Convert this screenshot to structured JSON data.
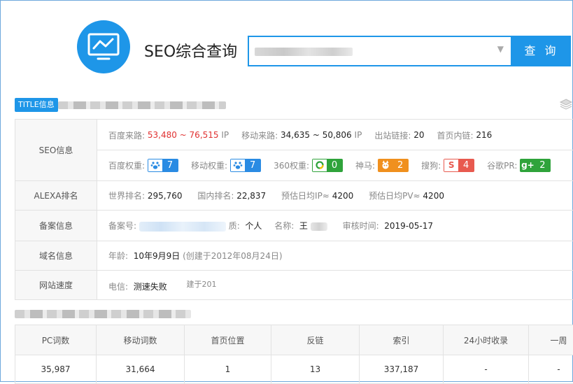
{
  "header": {
    "title": "SEO综合查询",
    "search_button": "查 询",
    "search_caret": "▼"
  },
  "title_badge": "TITLE信息",
  "seo": {
    "label": "SEO信息",
    "baidu_traffic_label": "百度来路:",
    "baidu_traffic_value": "53,480 ~ 76,515",
    "baidu_traffic_unit": "IP",
    "mobile_traffic_label": "移动来路:",
    "mobile_traffic_value": "34,635 ~ 50,806",
    "mobile_traffic_unit": "IP",
    "outbound_label": "出站链接:",
    "outbound_value": "20",
    "inner_label": "首页内链:",
    "inner_value": "216",
    "baidu_weight_label": "百度权重:",
    "baidu_weight_value": "7",
    "mobile_weight_label": "移动权重:",
    "mobile_weight_value": "7",
    "w360_label": "360权重:",
    "w360_value": "0",
    "shenma_label": "神马:",
    "shenma_value": "2",
    "sogou_label": "搜狗:",
    "sogou_value": "4",
    "sogou_glyph": "S",
    "google_label": "谷歌PR:",
    "google_value": "2",
    "google_glyph": "g+"
  },
  "alexa": {
    "label": "ALEXA排名",
    "world_label": "世界排名:",
    "world_value": "295,760",
    "domestic_label": "国内排名:",
    "domestic_value": "22,837",
    "ip_label": "预估日均IP≈",
    "ip_value": "4200",
    "pv_label": "预估日均PV≈",
    "pv_value": "4200"
  },
  "icp": {
    "label": "备案信息",
    "no_label": "备案号:",
    "nature_label": "质:",
    "nature_value": "个人",
    "name_label": "名称:",
    "name_value": "王",
    "review_label": "审核时间:",
    "review_value": "2019-05-17"
  },
  "domain": {
    "label": "域名信息",
    "age_label": "年龄:",
    "age_value": "10年9月9日",
    "created_note": "(创建于2012年08月24日)"
  },
  "speed": {
    "label": "网站速度",
    "telecom_label": "电信:",
    "telecom_value": "测速失败",
    "fragment": "建于201"
  },
  "kw_table": {
    "headers": [
      "PC词数",
      "移动词数",
      "首页位置",
      "反链",
      "索引",
      "24小时收录",
      "一周"
    ],
    "row": [
      "35,987",
      "31,664",
      "1",
      "13",
      "337,187",
      "-",
      "-"
    ]
  }
}
